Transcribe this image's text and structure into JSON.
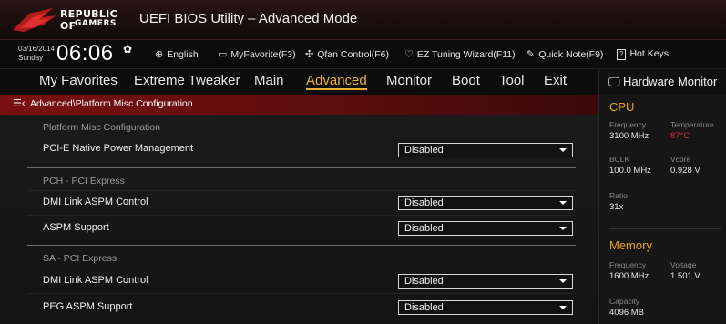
{
  "titlebar": {
    "brand_line1": "REPUBLIC OF",
    "brand_line2": "GAMERS",
    "title": "UEFI BIOS Utility – Advanced Mode"
  },
  "toolbar": {
    "date": "03/16/2014",
    "day": "Sunday",
    "time": "06:06",
    "items": [
      {
        "icon": "globe-icon",
        "label": "English"
      },
      {
        "icon": "favorite-icon",
        "label": "MyFavorite(F3)"
      },
      {
        "icon": "fan-icon",
        "label": "Qfan Control(F6)"
      },
      {
        "icon": "bulb-icon",
        "label": "EZ Tuning Wizard(F11)"
      },
      {
        "icon": "note-icon",
        "label": "Quick Note(F9)"
      },
      {
        "icon": "help-icon",
        "label": "Hot Keys"
      }
    ]
  },
  "menu": {
    "items": [
      "My Favorites",
      "Extreme Tweaker",
      "Main",
      "Advanced",
      "Monitor",
      "Boot",
      "Tool",
      "Exit"
    ],
    "active": "Advanced"
  },
  "breadcrumb": "Advanced\\Platform Misc Configuration",
  "content": {
    "sections": [
      {
        "title": "Platform Misc Configuration",
        "rows": [
          {
            "label": "PCI-E Native Power Management",
            "value": "Disabled"
          }
        ]
      },
      {
        "title": "PCH - PCI Express",
        "rows": [
          {
            "label": "DMI Link ASPM Control",
            "value": "Disabled"
          },
          {
            "label": "ASPM Support",
            "value": "Disabled"
          }
        ]
      },
      {
        "title": "SA - PCI Express",
        "rows": [
          {
            "label": "DMI Link ASPM Control",
            "value": "Disabled"
          },
          {
            "label": "PEG ASPM Support",
            "value": "Disabled"
          }
        ]
      }
    ]
  },
  "hardware_monitor": {
    "title": "Hardware Monitor",
    "cpu": {
      "section": "CPU",
      "frequency_label": "Frequency",
      "frequency": "3100 MHz",
      "temperature_label": "Temperature",
      "temperature": "87°C",
      "bclk_label": "BCLK",
      "bclk": "100.0 MHz",
      "vcore_label": "Vcore",
      "vcore": "0.928 V",
      "ratio_label": "Ratio",
      "ratio": "31x"
    },
    "memory": {
      "section": "Memory",
      "frequency_label": "Frequency",
      "frequency": "1600 MHz",
      "voltage_label": "Voltage",
      "voltage": "1.501 V",
      "capacity_label": "Capacity",
      "capacity": "4096 MB"
    },
    "colors": {
      "accent": "#e8a22a",
      "hot": "#d42a2a",
      "active_tab": "#e8b23a",
      "breadcrumb": "#7a1010"
    }
  }
}
